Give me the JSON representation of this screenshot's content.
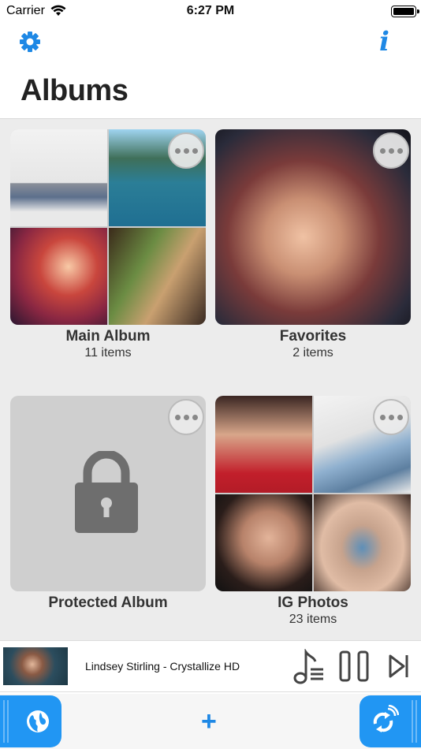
{
  "status_bar": {
    "carrier": "Carrier",
    "time": "6:27 PM"
  },
  "header": {
    "title": "Albums"
  },
  "albums": [
    {
      "name": "Main Album",
      "count": "11 items"
    },
    {
      "name": "Favorites",
      "count": "2 items"
    },
    {
      "name": "Protected Album",
      "count": ""
    },
    {
      "name": "IG Photos",
      "count": "23 items"
    }
  ],
  "player": {
    "track": "Lindsey Stirling - Crystallize HD"
  },
  "icons": {
    "settings": "gear-icon",
    "info": "info-icon",
    "more": "more-options-icon",
    "lock": "lock-icon",
    "playlist": "music-list-icon",
    "pause": "pause-icon",
    "next": "skip-next-icon",
    "browser": "globe-icon",
    "add": "plus-icon",
    "sync": "wifi-sync-icon"
  },
  "info_glyph": "i",
  "add_glyph": "+",
  "colors": {
    "accent": "#1e88e5",
    "toolbar_button": "#2196f3",
    "grid_background": "#ececec"
  }
}
